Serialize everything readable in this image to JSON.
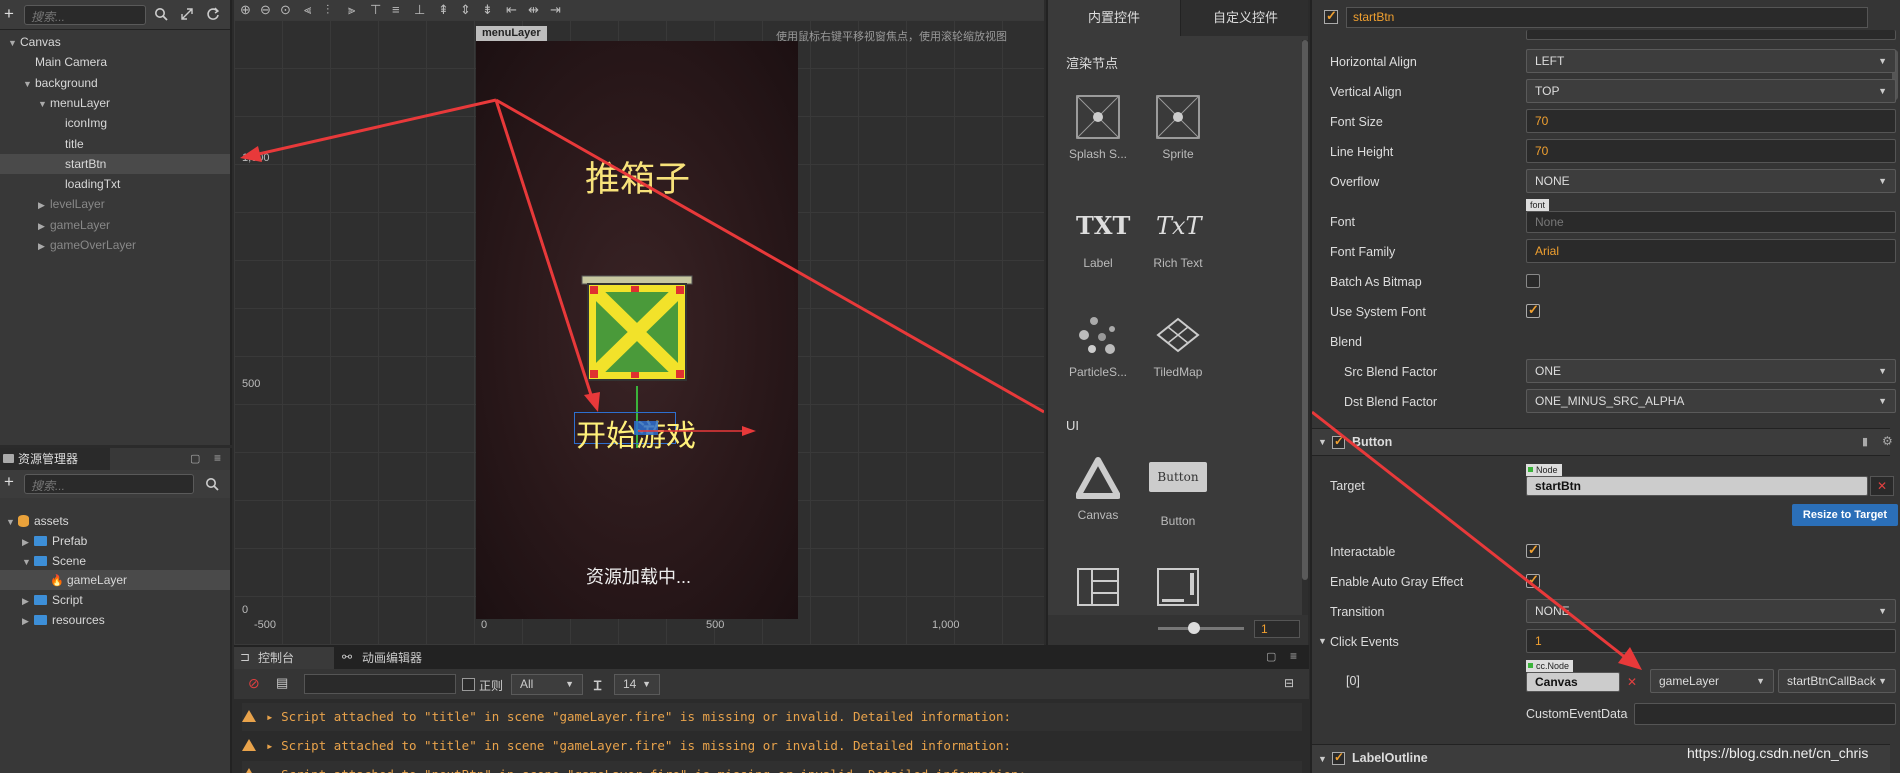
{
  "hierarchy": {
    "search_placeholder": "搜索...",
    "items": [
      {
        "label": "Canvas",
        "depth": 0,
        "arrow": "▼",
        "state": "normal"
      },
      {
        "label": "Main Camera",
        "depth": 1,
        "arrow": "",
        "state": "normal"
      },
      {
        "label": "background",
        "depth": 1,
        "arrow": "▼",
        "state": "normal"
      },
      {
        "label": "menuLayer",
        "depth": 2,
        "arrow": "▼",
        "state": "normal"
      },
      {
        "label": "iconImg",
        "depth": 3,
        "arrow": "",
        "state": "normal"
      },
      {
        "label": "title",
        "depth": 3,
        "arrow": "",
        "state": "normal"
      },
      {
        "label": "startBtn",
        "depth": 3,
        "arrow": "",
        "state": "selected"
      },
      {
        "label": "loadingTxt",
        "depth": 3,
        "arrow": "",
        "state": "normal"
      },
      {
        "label": "levelLayer",
        "depth": 2,
        "arrow": "▶",
        "state": "dim"
      },
      {
        "label": "gameLayer",
        "depth": 2,
        "arrow": "▶",
        "state": "dim"
      },
      {
        "label": "gameOverLayer",
        "depth": 2,
        "arrow": "▶",
        "state": "dim"
      }
    ]
  },
  "assets": {
    "title": "资源管理器",
    "search_placeholder": "搜索...",
    "items": [
      {
        "label": "assets",
        "depth": 0,
        "arrow": "▼",
        "kind": "db"
      },
      {
        "label": "Prefab",
        "depth": 1,
        "arrow": "▶",
        "kind": "folder"
      },
      {
        "label": "Scene",
        "depth": 1,
        "arrow": "▼",
        "kind": "folder"
      },
      {
        "label": "gameLayer",
        "depth": 2,
        "arrow": "",
        "kind": "fire",
        "selected": true
      },
      {
        "label": "Script",
        "depth": 1,
        "arrow": "▶",
        "kind": "folder"
      },
      {
        "label": "resources",
        "depth": 1,
        "arrow": "▶",
        "kind": "folder"
      }
    ]
  },
  "scene": {
    "hint": "使用鼠标右键平移视窗焦点，使用滚轮缩放视图",
    "node_label": "menuLayer",
    "axis_labels": [
      "1,000",
      "500",
      "0",
      "-500",
      "0",
      "500",
      "1,000"
    ],
    "title_text": "推箱子",
    "start_text": "开始游戏",
    "loading_text": "资源加载中..."
  },
  "widgets": {
    "tab_builtin": "内置控件",
    "tab_custom": "自定义控件",
    "section_render": "渲染节点",
    "section_ui": "UI",
    "items": [
      "Splash S...",
      "Sprite",
      "Label",
      "Rich Text",
      "ParticleS...",
      "TiledMap",
      "Canvas",
      "Button"
    ],
    "label_icon_text": "TXT",
    "richtext_icon_text": "TxT",
    "button_icon_text": "Button",
    "zoom_value": "1"
  },
  "console": {
    "tab_console": "控制台",
    "tab_anim": "动画编辑器",
    "regex_label": "正则",
    "filter_value": "All",
    "font_size": "14",
    "logs": [
      "Script attached to \"title\" in scene \"gameLayer.fire\" is missing or invalid. Detailed information:",
      "Script attached to \"title\" in scene \"gameLayer.fire\" is missing or invalid. Detailed information:",
      "Script attached to \"nextBtn\" in scene \"gameLayer.fire\" is missing or invalid. Detailed information:"
    ]
  },
  "inspector": {
    "node_name": "startBtn",
    "props": {
      "h_align_label": "Horizontal Align",
      "h_align": "LEFT",
      "v_align_label": "Vertical Align",
      "v_align": "TOP",
      "font_size_label": "Font Size",
      "font_size": "70",
      "line_height_label": "Line Height",
      "line_height": "70",
      "overflow_label": "Overflow",
      "overflow": "NONE",
      "font_label": "Font",
      "font_tag": "font",
      "font_value": "None",
      "font_family_label": "Font Family",
      "font_family": "Arial",
      "batch_label": "Batch As Bitmap",
      "system_font_label": "Use System Font",
      "blend_label": "Blend",
      "src_blend_label": "Src Blend Factor",
      "src_blend": "ONE",
      "dst_blend_label": "Dst Blend Factor",
      "dst_blend": "ONE_MINUS_SRC_ALPHA"
    },
    "button": {
      "title": "Button",
      "target_label": "Target",
      "target_tag": "Node",
      "target_value": "startBtn",
      "resize_button": "Resize to Target",
      "interactable_label": "Interactable",
      "auto_gray_label": "Enable Auto Gray Effect",
      "transition_label": "Transition",
      "transition": "NONE",
      "click_events_label": "Click Events",
      "click_events_count": "1",
      "event_index": "[0]",
      "event_node_tag": "cc.Node",
      "event_node": "Canvas",
      "event_component": "gameLayer",
      "event_handler": "startBtnCallBack",
      "custom_data_label": "CustomEventData"
    },
    "label_outline": "LabelOutline",
    "watermark": "https://blog.csdn.net/cn_chris"
  },
  "colors": {
    "accent": "#f0a030",
    "arrow": "#e8393a",
    "select_blue": "#2d6fcf"
  }
}
